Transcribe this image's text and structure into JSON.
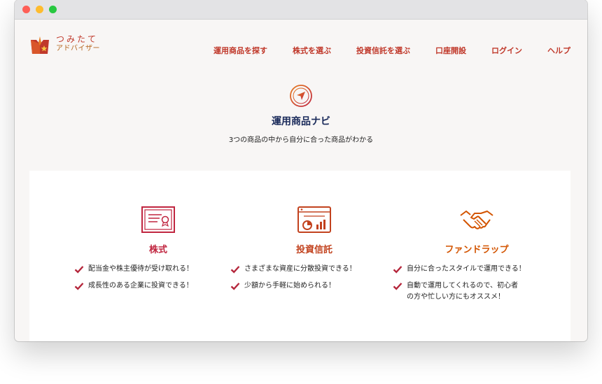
{
  "logo": {
    "line1": "つみたて",
    "line2": "アドバイザー"
  },
  "nav": [
    "運用商品を探す",
    "株式を選ぶ",
    "投資信託を選ぶ",
    "口座開設",
    "ログイン",
    "ヘルプ"
  ],
  "hero": {
    "title": "運用商品ナビ",
    "subtitle": "3つの商品の中から自分に合った商品がわかる"
  },
  "products": [
    {
      "title": "株式",
      "icon": "certificate-icon",
      "color": "#c0253f",
      "features": [
        "配当金や株主優待が受け取れる！",
        "成長性のある企業に投資できる！"
      ]
    },
    {
      "title": "投資信託",
      "icon": "chart-window-icon",
      "color": "#c2421e",
      "features": [
        "さまざまな資産に分散投資できる！",
        "少額から手軽に始められる！"
      ]
    },
    {
      "title": "ファンドラップ",
      "icon": "handshake-icon",
      "color": "#d35400",
      "features": [
        "自分に合ったスタイルで運用できる！",
        "自動で運用してくれるので、初心者\nの方や忙しい方にもオススメ！"
      ]
    }
  ],
  "colors": {
    "accent": "#c0392b",
    "check": "#b5273c",
    "title_navy": "#1a2a5a",
    "traffic_red": "#fe5f57",
    "traffic_yellow": "#febc2e",
    "traffic_green": "#28c840"
  }
}
